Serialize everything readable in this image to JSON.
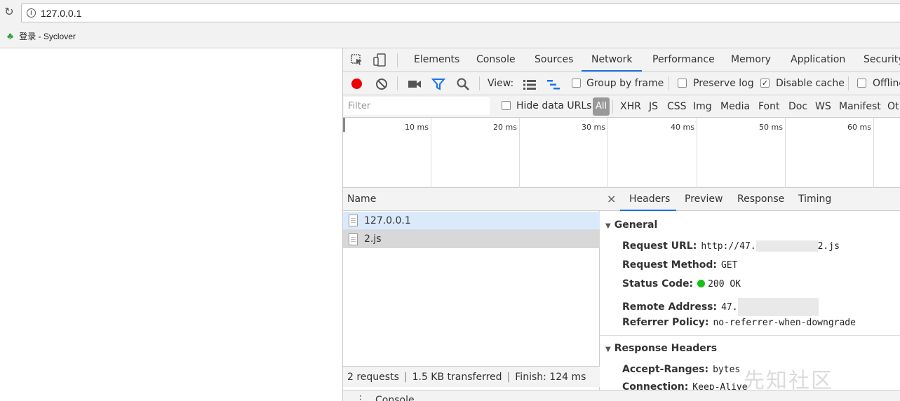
{
  "browser": {
    "url": "127.0.0.1",
    "bookmark_label": "登录 - Syclover"
  },
  "devtools": {
    "tabs": [
      "Elements",
      "Console",
      "Sources",
      "Network",
      "Performance",
      "Memory",
      "Application",
      "Security"
    ],
    "active_tab": "Network",
    "toolbar": {
      "view_label": "View:",
      "group_by_frame": "Group by frame",
      "preserve_log": "Preserve log",
      "disable_cache": "Disable cache",
      "offline": "Offline"
    },
    "filter": {
      "placeholder": "Filter",
      "hide_data_urls": "Hide data URLs",
      "types": [
        "All",
        "XHR",
        "JS",
        "CSS",
        "Img",
        "Media",
        "Font",
        "Doc",
        "WS",
        "Manifest",
        "Ot"
      ]
    },
    "timeline_ticks": [
      "10 ms",
      "20 ms",
      "30 ms",
      "40 ms",
      "50 ms",
      "60 ms"
    ],
    "name_header": "Name",
    "requests": [
      {
        "name": "127.0.0.1"
      },
      {
        "name": "2.js"
      }
    ],
    "status": {
      "requests": "2 requests",
      "transferred": "1.5 KB transferred",
      "finish": "Finish: 124 ms"
    },
    "detail": {
      "close": "×",
      "tabs": [
        "Headers",
        "Preview",
        "Response",
        "Timing"
      ],
      "general_title": "General",
      "general": {
        "request_url_key": "Request URL:",
        "request_url_prefix": "http://47.",
        "request_url_suffix": "2.js",
        "request_method_key": "Request Method:",
        "request_method": "GET",
        "status_code_key": "Status Code:",
        "status_code": "200 OK",
        "remote_address_key": "Remote Address:",
        "remote_address": "47.",
        "referrer_policy_key": "Referrer Policy:",
        "referrer_policy": "no-referrer-when-downgrade"
      },
      "response_headers_title": "Response Headers",
      "response_headers": {
        "accept_ranges_key": "Accept-Ranges:",
        "accept_ranges": "bytes",
        "connection_key": "Connection:",
        "connection": "Keep-Alive"
      }
    },
    "drawer_label": "Console"
  },
  "watermark": "先知社区",
  "colors": {
    "record": "#ee0000",
    "accent": "#1a73e8",
    "selected_row": "#dbeafa",
    "hover_row": "#d8d8d8",
    "status_ok": "#17c017"
  }
}
